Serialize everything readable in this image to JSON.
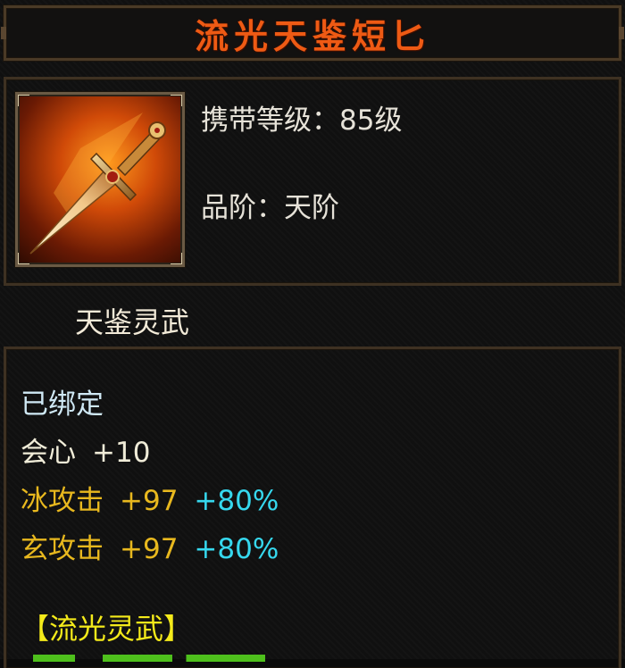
{
  "item": {
    "name": "流光天鉴短匕",
    "level_label": "携带等级：85级",
    "grade_label": "品阶：天阶",
    "icon": "dagger-icon"
  },
  "section": {
    "title": "天鉴灵武"
  },
  "stats": {
    "bound": "已绑定",
    "crit": {
      "label": "会心",
      "value": "+10"
    },
    "ice_attack": {
      "label": "冰攻击",
      "value": "+97",
      "percent": "+80%"
    },
    "mystic_attack": {
      "label": "玄攻击",
      "value": "+97",
      "percent": "+80%"
    }
  },
  "set": {
    "title": "【流光灵武】"
  },
  "colors": {
    "title": "#ee5a14",
    "gold_stat": "#e8b81e",
    "percent": "#36d8ee",
    "set_title": "#f4ea1a",
    "bound": "#cfe8f4"
  }
}
